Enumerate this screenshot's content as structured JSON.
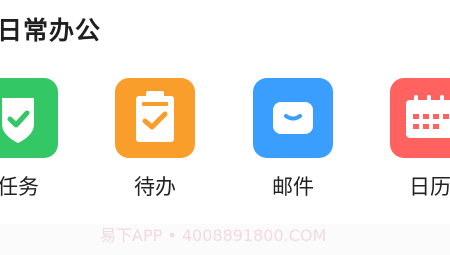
{
  "section": {
    "title": "日常办公"
  },
  "apps": [
    {
      "label": "任务",
      "icon": "shield-check-icon",
      "color": "#34c765"
    },
    {
      "label": "待办",
      "icon": "clipboard-check-icon",
      "color": "#f99d2b"
    },
    {
      "label": "邮件",
      "icon": "mail-icon",
      "color": "#3a9eff"
    },
    {
      "label": "日历",
      "icon": "calendar-icon",
      "color": "#ff625f"
    }
  ],
  "watermark": {
    "text": "易下APP • 4008891800.COM"
  }
}
